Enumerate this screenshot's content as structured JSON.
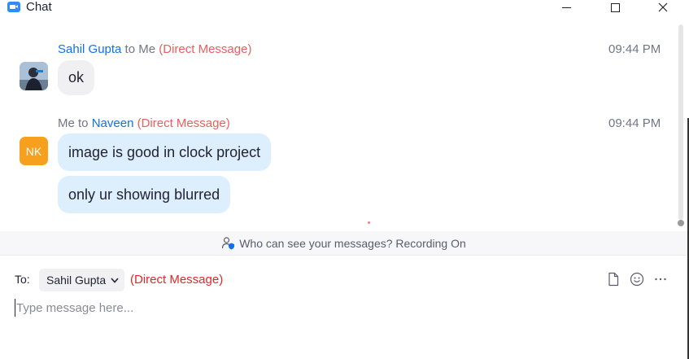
{
  "window": {
    "title": "Chat"
  },
  "messages": [
    {
      "sender": "Sahil Gupta",
      "connector": " to ",
      "recipient": "Me",
      "tag": "(Direct Message)",
      "time": "09:44 PM",
      "bubbles": [
        "ok"
      ]
    },
    {
      "sender": "Me",
      "connector": " to ",
      "recipient": "Naveen",
      "tag": "(Direct Message)",
      "time": "09:44 PM",
      "avatar_initials": "NK",
      "bubbles": [
        "image is good in clock project",
        "only ur showing blurred"
      ]
    }
  ],
  "notice": {
    "text": "Who can see your messages? Recording On"
  },
  "composer": {
    "to_label": "To:",
    "recipient": "Sahil Gupta",
    "tag": "(Direct Message)",
    "placeholder": "Type message here..."
  },
  "colors": {
    "accent": "#0e72ed",
    "dm_tag": "#e8605e",
    "avatar_nk": "#f7a01d",
    "my_bubble": "#ddeefc",
    "their_bubble": "#f0f0f3"
  }
}
